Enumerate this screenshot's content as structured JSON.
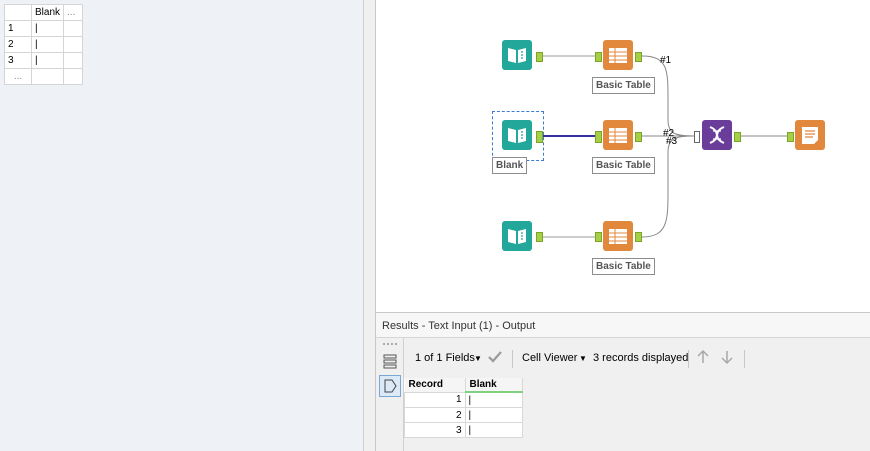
{
  "left_grid": {
    "header": "Blank",
    "extra_header": "...",
    "rows": [
      {
        "num": "1",
        "value": "|"
      },
      {
        "num": "2",
        "value": "|"
      },
      {
        "num": "3",
        "value": "|"
      }
    ],
    "more_marker": "..."
  },
  "canvas": {
    "basic_table_label": "Basic Table",
    "blank_label": "Blank",
    "union_badges": [
      "#1",
      "#2",
      "#3"
    ],
    "colors": {
      "input": "#22a79a",
      "table": "#e1883c",
      "union": "#6a3d9a",
      "anchor": "#a5d046",
      "selected_link": "#3a2fa0"
    }
  },
  "results": {
    "title": "Results - Text Input (1) - Output",
    "fields_label": "1 of 1 Fields",
    "viewer_label": "Cell Viewer",
    "records_label": "3 records displayed",
    "table": {
      "columns": [
        "Record",
        "Blank"
      ],
      "rows": [
        {
          "record": "1",
          "blank": "|"
        },
        {
          "record": "2",
          "blank": "|"
        },
        {
          "record": "3",
          "blank": "|"
        }
      ]
    }
  }
}
